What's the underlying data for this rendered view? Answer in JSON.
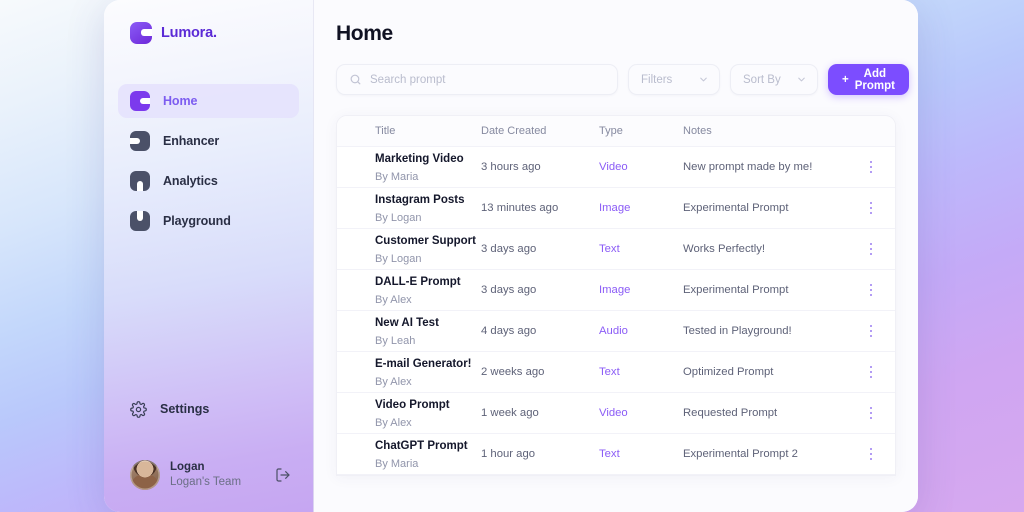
{
  "brand": {
    "name": "Lumora.",
    "logo_icon": "lumora-mark",
    "accent": "#7c3aed"
  },
  "sidebar": {
    "items": [
      {
        "label": "Home",
        "icon": "lumora-notch-right-icon",
        "active": true
      },
      {
        "label": "Enhancer",
        "icon": "lumora-notch-left-icon",
        "active": false
      },
      {
        "label": "Analytics",
        "icon": "lumora-notch-down-icon",
        "active": false
      },
      {
        "label": "Playground",
        "icon": "lumora-notch-up-icon",
        "active": false
      }
    ],
    "settings": {
      "label": "Settings",
      "icon": "gear-icon"
    },
    "user": {
      "name": "Logan",
      "team": "Logan's Team",
      "avatar_icon": "user-avatar",
      "logout_icon": "logout-icon"
    }
  },
  "header": {
    "title": "Home"
  },
  "toolbar": {
    "search": {
      "placeholder": "Search prompt",
      "value": "",
      "icon": "search-icon"
    },
    "filters": {
      "label": "Filters",
      "icon": "chevron-down-icon"
    },
    "sort_by": {
      "label": "Sort By",
      "icon": "chevron-down-icon"
    },
    "add_prompt": {
      "label": "Add Prompt",
      "plus": "+",
      "color": "#7c4dff"
    }
  },
  "table": {
    "columns": [
      "Title",
      "Date Created",
      "Type",
      "Notes"
    ],
    "row_menu_icon": "kebab-menu-icon",
    "rows": [
      {
        "title": "Marketing Video",
        "author": "By Maria",
        "date": "3 hours ago",
        "type": "Video",
        "notes": "New prompt made by me!"
      },
      {
        "title": "Instagram Posts",
        "author": "By Logan",
        "date": "13 minutes ago",
        "type": "Image",
        "notes": "Experimental Prompt"
      },
      {
        "title": "Customer Support",
        "author": "By Logan",
        "date": "3 days ago",
        "type": "Text",
        "notes": "Works Perfectly!"
      },
      {
        "title": "DALL-E Prompt",
        "author": "By Alex",
        "date": "3 days ago",
        "type": "Image",
        "notes": "Experimental Prompt"
      },
      {
        "title": "New AI Test",
        "author": "By Leah",
        "date": "4 days ago",
        "type": "Audio",
        "notes": "Tested in Playground!"
      },
      {
        "title": "E-mail Generator!",
        "author": "By Alex",
        "date": "2 weeks ago",
        "type": "Text",
        "notes": "Optimized Prompt"
      },
      {
        "title": "Video Prompt",
        "author": "By Alex",
        "date": "1 week ago",
        "type": "Video",
        "notes": "Requested Prompt"
      },
      {
        "title": "ChatGPT Prompt",
        "author": "By Maria",
        "date": "1 hour ago",
        "type": "Text",
        "notes": "Experimental Prompt 2"
      }
    ]
  }
}
